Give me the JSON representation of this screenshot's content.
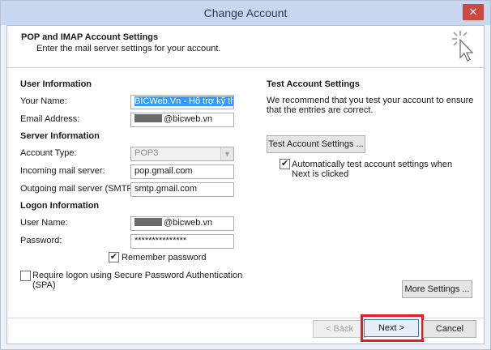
{
  "window": {
    "title": "Change Account",
    "close_glyph": "✕"
  },
  "header": {
    "title": "POP and IMAP Account Settings",
    "subtitle": "Enter the mail server settings for your account.",
    "icon": "cursor-click-icon"
  },
  "user_info": {
    "section_title": "User Information",
    "your_name_label": "Your Name:",
    "your_name_value": "BICWeb.Vn - Hỗ trợ kỹ thuật",
    "email_label": "Email Address:",
    "email_value": "@bicweb.vn"
  },
  "server_info": {
    "section_title": "Server Information",
    "account_type_label": "Account Type:",
    "account_type_value": "POP3",
    "incoming_label": "Incoming mail server:",
    "incoming_value": "pop.gmail.com",
    "outgoing_label": "Outgoing mail server (SMTP):",
    "outgoing_value": "smtp.gmail.com"
  },
  "logon_info": {
    "section_title": "Logon Information",
    "username_label": "User Name:",
    "username_value": "@bicweb.vn",
    "password_label": "Password:",
    "password_value": "***************",
    "remember_label": "Remember password",
    "remember_checked": true,
    "spa_label": "Require logon using Secure Password Authentication (SPA)",
    "spa_checked": false
  },
  "test": {
    "section_title": "Test Account Settings",
    "description": "We recommend that you test your account to ensure that the entries are correct.",
    "test_button": "Test Account Settings ...",
    "auto_test_label": "Automatically test account settings when Next is clicked",
    "auto_test_checked": true
  },
  "more_settings_button": "More Settings ...",
  "footer": {
    "back_button": "< Back",
    "next_button": "Next >",
    "cancel_button": "Cancel"
  },
  "colors": {
    "highlight": "#e01f25",
    "close_button": "#c94a40",
    "selection": "#3399ff"
  }
}
